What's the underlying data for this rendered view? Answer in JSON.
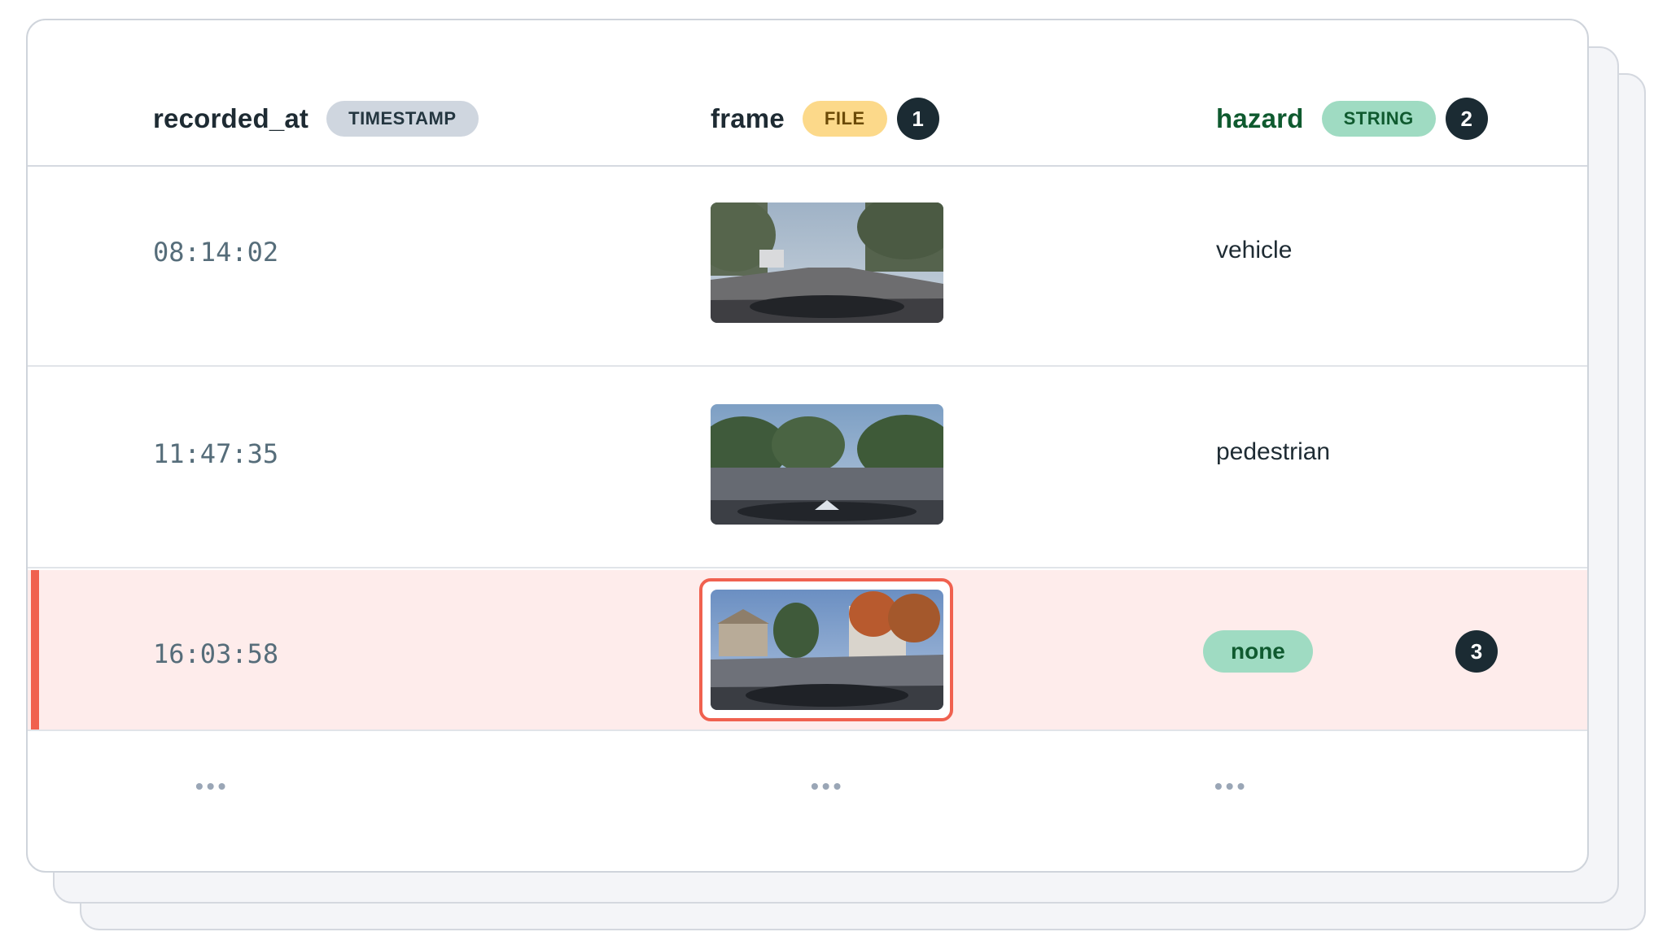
{
  "columns": [
    {
      "name": "recorded_at",
      "type": "TIMESTAMP"
    },
    {
      "name": "frame",
      "type": "FILE",
      "marker": "1"
    },
    {
      "name": "hazard",
      "type": "STRING",
      "marker": "2"
    }
  ],
  "rows": [
    {
      "recorded_at": "08:14:02",
      "frame": "frame-thumbnail",
      "hazard": "vehicle"
    },
    {
      "recorded_at": "11:47:35",
      "frame": "frame-thumbnail",
      "hazard": "pedestrian"
    },
    {
      "recorded_at": "16:03:58",
      "frame": "frame-thumbnail",
      "hazard": "none",
      "marker": "3",
      "highlighted": true
    }
  ],
  "continuation": {
    "col1": "•••",
    "col2": "•••",
    "col3": "•••"
  },
  "colors": {
    "highlight_row": "#feeceb",
    "highlight_accent": "#f0614f",
    "marker_bg": "#1b2b33",
    "hazard_header": "#0f5a2f",
    "badge_timestamp": "#cfd6df",
    "badge_file": "#fcd98a",
    "badge_string": "#9fdbc2"
  }
}
